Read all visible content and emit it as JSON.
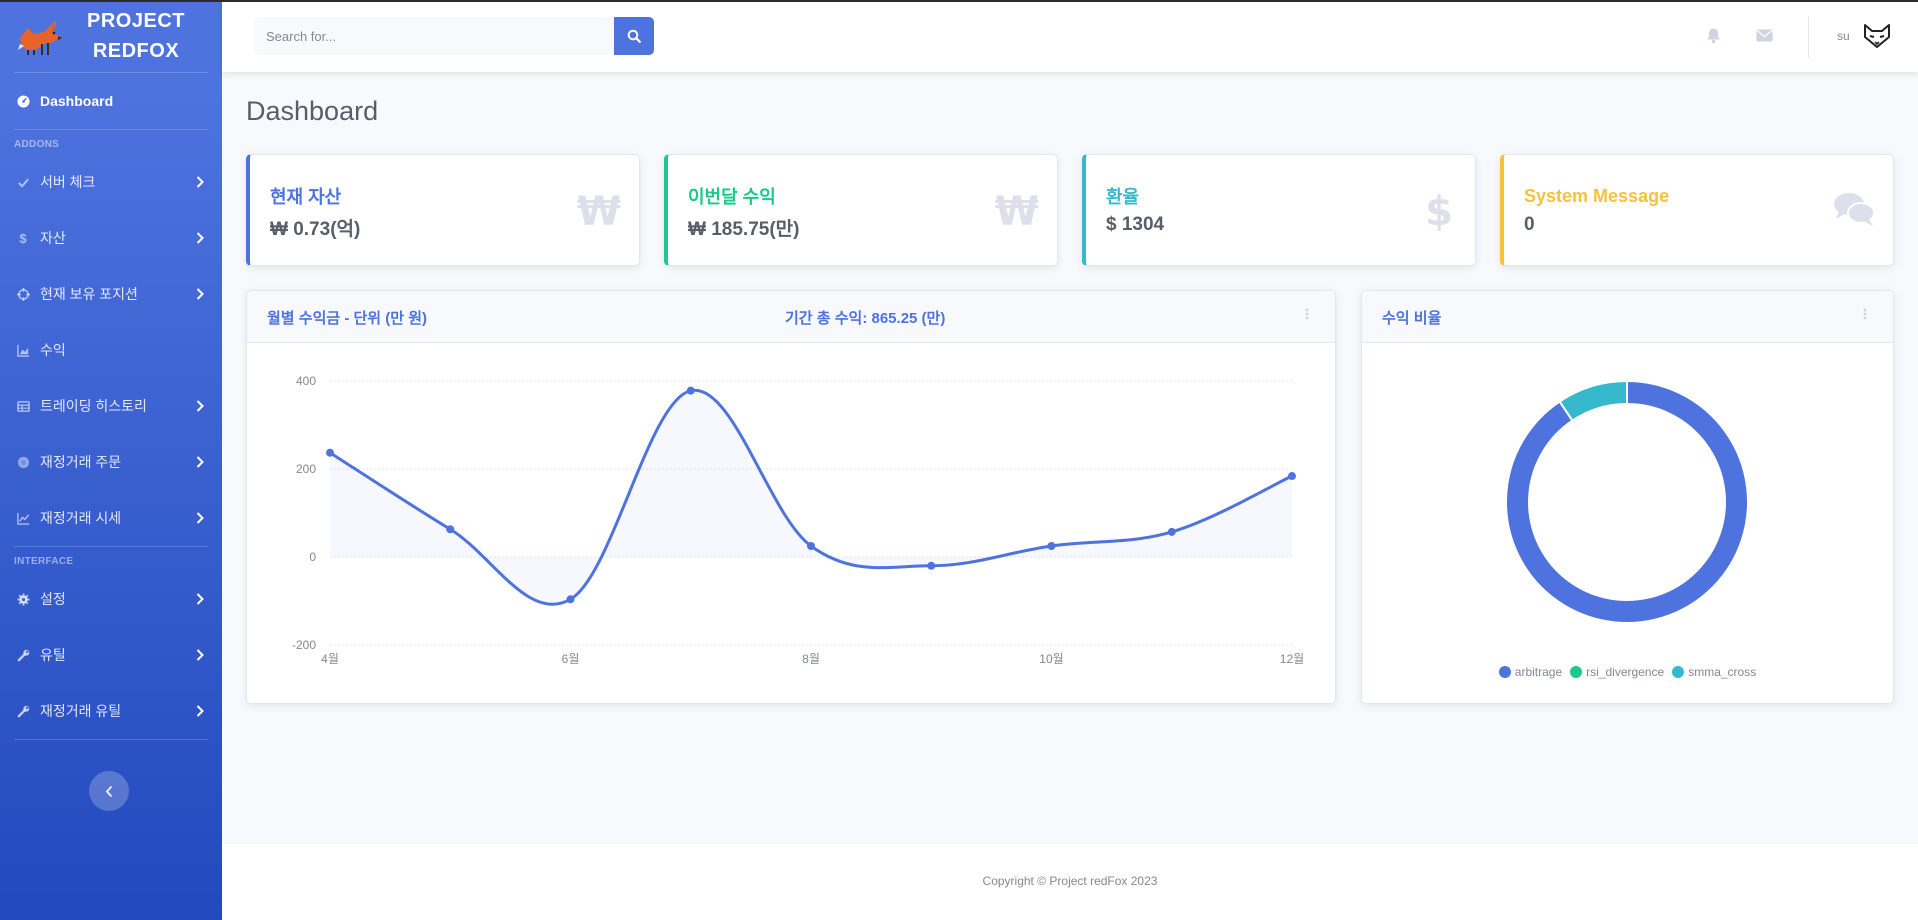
{
  "brand": {
    "line1": "PROJECT",
    "line2": "REDFOX"
  },
  "sidebar": {
    "dashboard": "Dashboard",
    "heading_addons": "ADDONS",
    "heading_interface": "INTERFACE",
    "items": [
      {
        "label": "서버 체크",
        "icon": "check-icon"
      },
      {
        "label": "자산",
        "icon": "dollar-icon"
      },
      {
        "label": "현재 보유 포지션",
        "icon": "crosshairs-icon"
      },
      {
        "label": "수익",
        "icon": "chart-area-icon"
      },
      {
        "label": "트레이딩 히스토리",
        "icon": "table-icon"
      },
      {
        "label": "재정거래 주문",
        "icon": "circle-icon"
      },
      {
        "label": "재정거래 시세",
        "icon": "chart-line-icon"
      },
      {
        "label": "설정",
        "icon": "cog-icon"
      },
      {
        "label": "유틸",
        "icon": "wrench-icon"
      },
      {
        "label": "재정거래 유틸",
        "icon": "wrench-icon"
      }
    ]
  },
  "topbar": {
    "search_placeholder": "Search for...",
    "user": "su"
  },
  "page": {
    "title": "Dashboard"
  },
  "stats": [
    {
      "label": "현재 자산",
      "value": "₩ 0.73(억)",
      "icon": "₩",
      "color": "#4e73df"
    },
    {
      "label": "이번달 수익",
      "value": "₩ 185.75(만)",
      "icon": "₩",
      "color": "#1cc88a"
    },
    {
      "label": "환율",
      "value": "$ 1304",
      "icon": "$",
      "color": "#36b9cc"
    },
    {
      "label": "System Message",
      "value": "0",
      "icon": "comments-icon",
      "color": "#f6c23e"
    }
  ],
  "line_card": {
    "title": "월별 수익금 - 단위 (만 원)",
    "total": "기간 총 수익: 865.25 (만)"
  },
  "pie_card": {
    "title": "수익 비율"
  },
  "footer": {
    "copyright": "Copyright © Project redFox 2023"
  },
  "chart_data": [
    {
      "type": "line",
      "x": [
        "4월",
        "5월",
        "6월",
        "7월",
        "8월",
        "9월",
        "10월",
        "11월",
        "12월"
      ],
      "x_tick_labels": [
        "4월",
        "6월",
        "8월",
        "10월",
        "12월"
      ],
      "values": [
        237,
        63,
        -96,
        378,
        25,
        -20,
        25,
        57,
        184
      ],
      "ylim": [
        -200,
        400
      ],
      "y_ticks": [
        -200,
        0,
        200,
        400
      ],
      "color": "#4e73df",
      "grid": true
    },
    {
      "type": "pie",
      "labels": [
        "arbitrage",
        "rsi_divergence",
        "smma_cross"
      ],
      "values": [
        90.6,
        0.0,
        9.4
      ],
      "colors": [
        "#4e73df",
        "#1cc88a",
        "#36b9cc"
      ],
      "legend": "bottom"
    }
  ]
}
